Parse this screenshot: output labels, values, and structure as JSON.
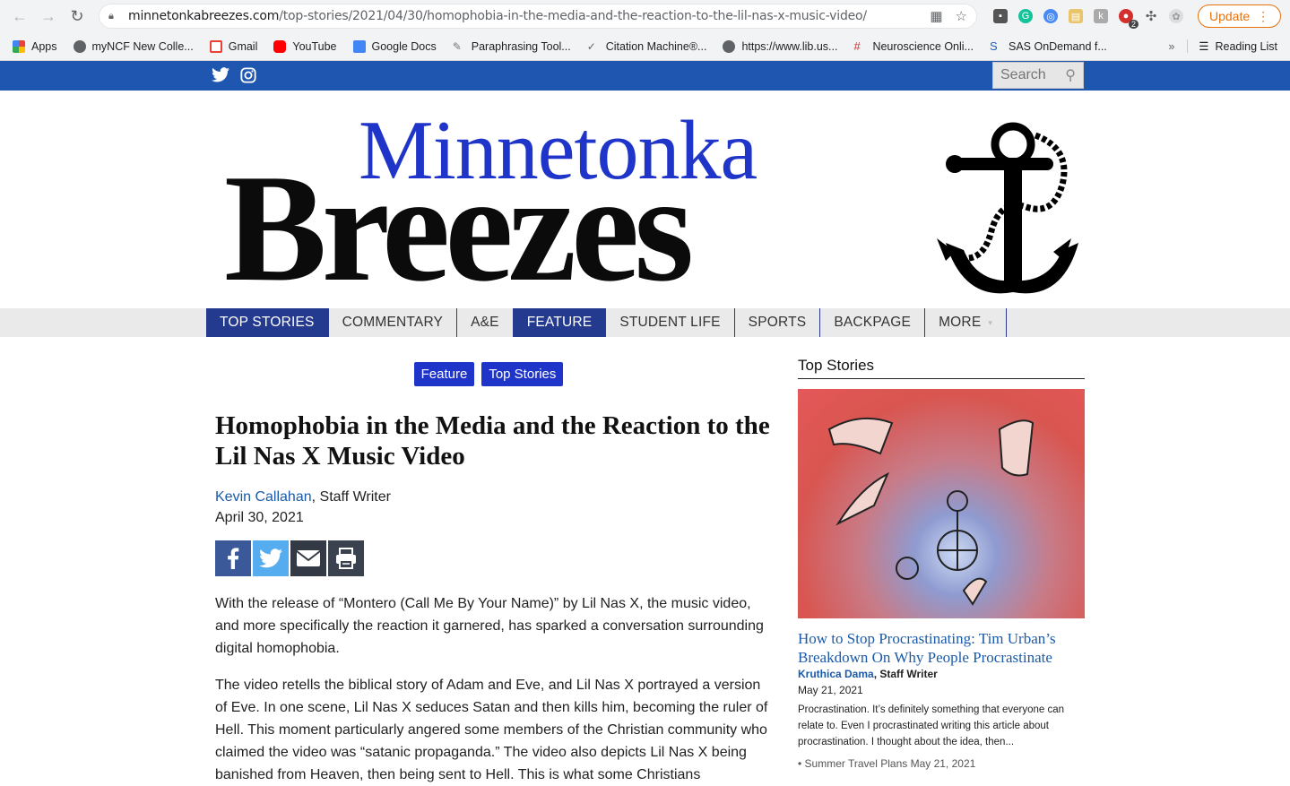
{
  "browser": {
    "url_domain": "minnetonkabreezes.com",
    "url_path": "/top-stories/2021/04/30/homophobia-in-the-media-and-the-reaction-to-the-lil-nas-x-music-video/",
    "update_label": "Update",
    "ext_badge": "2",
    "bookmarks": [
      {
        "label": "Apps",
        "color": "#4285f4"
      },
      {
        "label": "myNCF New Colle...",
        "color": "#5f6368"
      },
      {
        "label": "Gmail",
        "color": "#ea4335"
      },
      {
        "label": "YouTube",
        "color": "#ff0000"
      },
      {
        "label": "Google Docs",
        "color": "#4285f4"
      },
      {
        "label": "Paraphrasing Tool...",
        "color": "#888888"
      },
      {
        "label": "Citation Machine®...",
        "color": "#666666"
      },
      {
        "label": "https://www.lib.us...",
        "color": "#5f6368"
      },
      {
        "label": "Neuroscience Onli...",
        "color": "#c0392b"
      },
      {
        "label": "SAS OnDemand f...",
        "color": "#1f5fbf"
      }
    ],
    "reading_list": "Reading List"
  },
  "site": {
    "search_placeholder": "Search",
    "logo_top": "Minnetonka",
    "logo_bottom": "Breezes",
    "menu": [
      {
        "label": "TOP STORIES",
        "active": true
      },
      {
        "label": "COMMENTARY",
        "active": false
      },
      {
        "label": "A&E",
        "active": false
      },
      {
        "label": "FEATURE",
        "active": true
      },
      {
        "label": "STUDENT LIFE",
        "active": false
      },
      {
        "label": "SPORTS",
        "active": false
      },
      {
        "label": "BACKPAGE",
        "active": false
      },
      {
        "label": "MORE",
        "active": false
      }
    ]
  },
  "article": {
    "categories": [
      "Feature",
      "Top Stories"
    ],
    "title": "Homophobia in the Media and the Reaction to the Lil Nas X Music Video",
    "author": "Kevin Callahan",
    "author_role": ", Staff Writer",
    "date": "April 30, 2021",
    "paragraphs": [
      "With the release of “Montero (Call Me By Your Name)” by Lil Nas X, the music video, and more specifically the reaction it garnered, has sparked a conversation surrounding digital homophobia.",
      "The video retells the biblical story of Adam and Eve, and Lil Nas X portrayed a version of Eve. In one scene, Lil Nas X seduces Satan and then kills him, becoming the ruler of Hell. This moment particularly angered some members of the Christian community who claimed the video was “satanic propaganda.” The video also depicts Lil Nas X being banished from Heaven, then being sent to Hell. This is what some Christians"
    ]
  },
  "sidebar": {
    "heading": "Top Stories",
    "story_title": "How to Stop Procrastinating: Tim Urban’s Breakdown On Why People Procrastinate",
    "story_author": "Kruthica Dama",
    "story_author_role": ", Staff Writer",
    "story_date": "May 21, 2021",
    "story_excerpt": "Procrastination. It’s definitely something that everyone can relate to. Even I procrastinated writing this article about procrastination. I thought about the idea, then...",
    "next_item": "• Summer Travel Plans   May 21, 2021"
  },
  "colors": {
    "topbar": "#1f57b0",
    "menu_active": "#243a8e",
    "category_pill": "#1f35c9",
    "link": "#1a5aa8",
    "facebook": "#3b5998",
    "twitter": "#55acee",
    "email": "#333a45",
    "print": "#3a4250"
  }
}
